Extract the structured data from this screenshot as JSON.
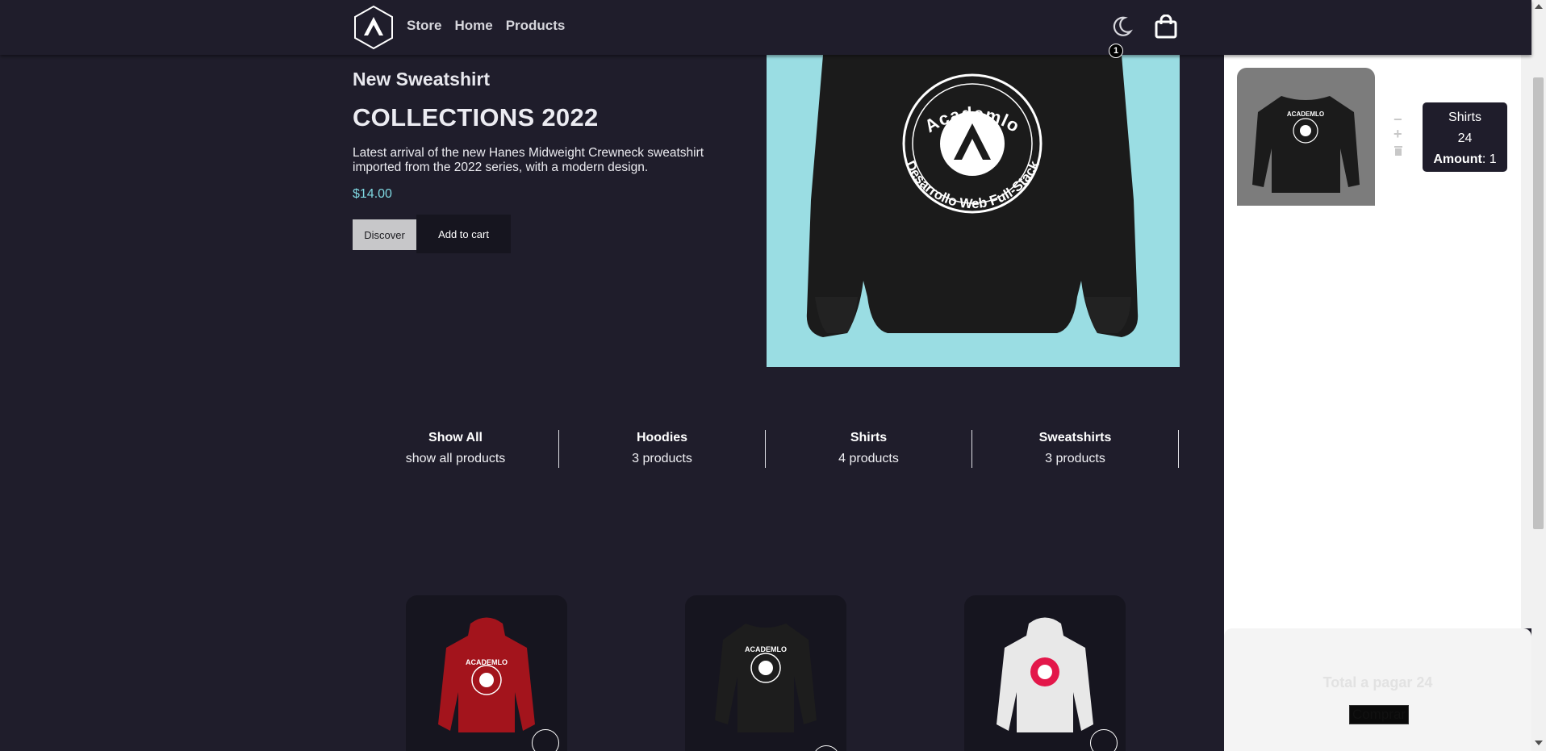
{
  "nav": {
    "items": [
      {
        "label": "Store"
      },
      {
        "label": "Home"
      },
      {
        "label": "Products"
      }
    ],
    "cart_count": "1"
  },
  "hero": {
    "subtitle": "New Sweatshirt",
    "title": "COLLECTIONS 2022",
    "description": "Latest arrival of the new Hanes Midweight Crewneck sweatshirt imported from the 2022 series, with a modern design.",
    "price": "$14.00",
    "discover_label": "Discover",
    "add_label": "Add to cart",
    "image_top_text": "Academlo",
    "image_bottom_text": "Desarrollo Web Full-Stack"
  },
  "categories": [
    {
      "name": "Show All",
      "count": "show all products"
    },
    {
      "name": "Hoodies",
      "count": "3 products"
    },
    {
      "name": "Shirts",
      "count": "4 products"
    },
    {
      "name": "Sweatshirts",
      "count": "3 products"
    }
  ],
  "products": [
    {
      "product_color": "#a3141c"
    },
    {
      "product_color": "#1d1d1d"
    },
    {
      "product_color": "#e8e8e8"
    }
  ],
  "cart": {
    "item": {
      "name": "Shirts",
      "price": "24",
      "amount_label": "Amount",
      "amount": ": 1"
    },
    "total": "Total a pagar 24",
    "buy_label": "Comprar"
  },
  "colors": {
    "background": "#1f1d2b",
    "price": "#7fd8e2",
    "hero_bg": "#9adde3"
  }
}
